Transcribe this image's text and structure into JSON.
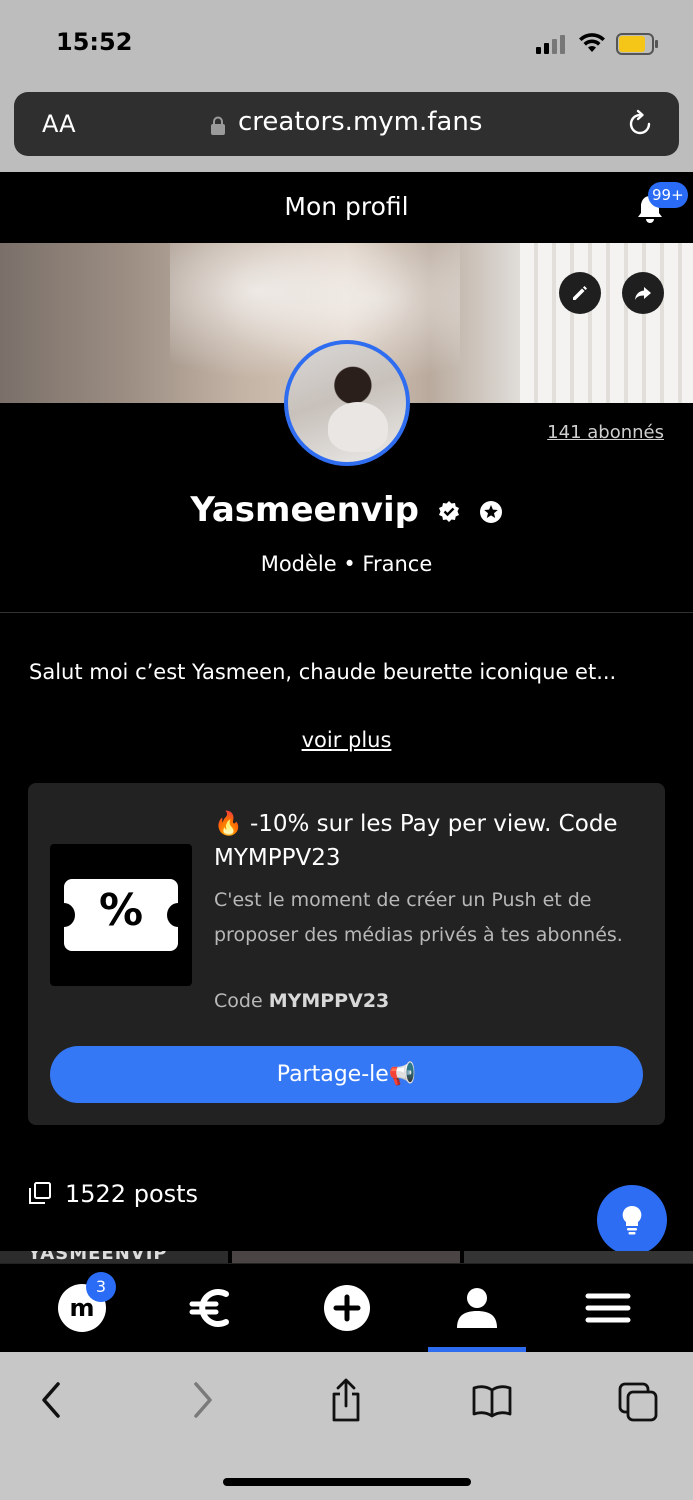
{
  "status_bar": {
    "time": "15:52"
  },
  "browser": {
    "text_size_label": "AA",
    "url": "creators.mym.fans"
  },
  "header": {
    "title": "Mon profil",
    "notifications_badge": "99+"
  },
  "profile": {
    "subscribers": "141 abonnés",
    "username": "Yasmeenvip",
    "meta": "Modèle • France",
    "bio": "Salut moi c’est Yasmeen, chaude beurette iconique et...",
    "see_more": "voir plus"
  },
  "promo": {
    "title": "🔥 -10% sur les Pay per view. Code MYMPPV23",
    "description": "C'est le moment de créer un Push et de proposer des médias privés à tes abonnés.",
    "code_prefix": "Code ",
    "code": "MYMPPV23",
    "share_label": "Partage-le📢",
    "thumb_symbol": "%"
  },
  "posts": {
    "count_label": "1522 posts"
  },
  "grid_peek": {
    "first_label": "YASMEENVIP"
  },
  "tabbar": {
    "messages_badge": "3",
    "active_tab": "profile"
  },
  "colors": {
    "accent": "#2f6df0",
    "button": "#3578f6",
    "card_bg": "#222222",
    "browser_chrome": "#bdbdbd"
  }
}
